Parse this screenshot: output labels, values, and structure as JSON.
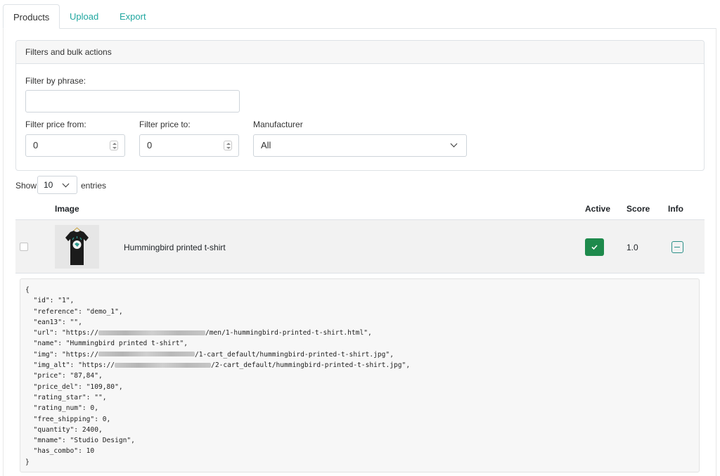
{
  "tabs": [
    {
      "label": "Products",
      "active": true
    },
    {
      "label": "Upload",
      "active": false
    },
    {
      "label": "Export",
      "active": false
    }
  ],
  "filters": {
    "header": "Filters and bulk actions",
    "phrase_label": "Filter by phrase:",
    "phrase_value": "",
    "price_from_label": "Filter price from:",
    "price_from_value": "0",
    "price_to_label": "Filter price to:",
    "price_to_value": "0",
    "manufacturer_label": "Manufacturer",
    "manufacturer_value": "All"
  },
  "length": {
    "show": "Show",
    "value": "10",
    "entries": "entries"
  },
  "table": {
    "headers": {
      "image": "Image",
      "active": "Active",
      "score": "Score",
      "info": "Info"
    },
    "rows": [
      {
        "name": "Hummingbird printed t-shirt",
        "active": true,
        "score": "1.0"
      }
    ]
  },
  "json_detail": {
    "open": "{",
    "close": "}",
    "lines": [
      {
        "pre": "  \"id\": \"1\",",
        "post": ""
      },
      {
        "pre": "  \"reference\": \"demo_1\",",
        "post": ""
      },
      {
        "pre": "  \"ean13\": \"\",",
        "post": ""
      },
      {
        "pre": "  \"url\": \"https://",
        "post": "/men/1-hummingbird-printed-t-shirt.html\","
      },
      {
        "pre": "  \"name\": \"Hummingbird printed t-shirt\",",
        "post": ""
      },
      {
        "pre": "  \"img\": \"https://",
        "post": "/1-cart_default/hummingbird-printed-t-shirt.jpg\","
      },
      {
        "pre": "  \"img_alt\": \"https://",
        "post": "/2-cart_default/hummingbird-printed-t-shirt.jpg\","
      },
      {
        "pre": "  \"price\": \"87,84\",",
        "post": ""
      },
      {
        "pre": "  \"price_del\": \"109,80\",",
        "post": ""
      },
      {
        "pre": "  \"rating_star\": \"\",",
        "post": ""
      },
      {
        "pre": "  \"rating_num\": 0,",
        "post": ""
      },
      {
        "pre": "  \"free_shipping\": 0,",
        "post": ""
      },
      {
        "pre": "  \"quantity\": 2400,",
        "post": ""
      },
      {
        "pre": "  \"mname\": \"Studio Design\",",
        "post": ""
      },
      {
        "pre": "  \"has_combo\": 10",
        "post": ""
      }
    ]
  },
  "colors": {
    "tab_link": "#20a7a0",
    "active_green": "#1e8a4c",
    "info_teal": "#2a8f87"
  }
}
